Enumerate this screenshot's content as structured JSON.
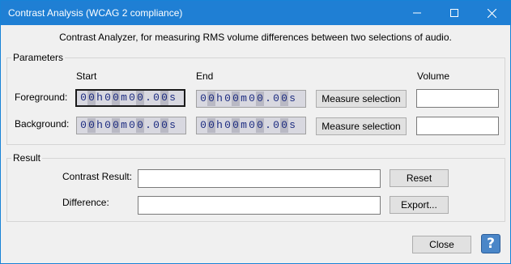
{
  "window": {
    "title": "Contrast Analysis (WCAG 2 compliance)",
    "controls": {
      "minimize": "minimize-icon",
      "maximize": "maximize-icon",
      "close": "close-icon"
    }
  },
  "description": "Contrast Analyzer, for measuring RMS volume differences between two selections of audio.",
  "parameters": {
    "group_label": "Parameters",
    "col_start": "Start",
    "col_end": "End",
    "col_volume": "Volume",
    "foreground": {
      "label": "Foreground:",
      "start": [
        "0",
        "0",
        "h",
        "0",
        "0",
        "m",
        "0",
        "0",
        ".",
        "0",
        "0",
        "s"
      ],
      "end": [
        "0",
        "0",
        "h",
        "0",
        "0",
        "m",
        "0",
        "0",
        ".",
        "0",
        "0",
        "s"
      ],
      "measure_label": "Measure selection",
      "volume": ""
    },
    "background": {
      "label": "Background:",
      "start": [
        "0",
        "0",
        "h",
        "0",
        "0",
        "m",
        "0",
        "0",
        ".",
        "0",
        "0",
        "s"
      ],
      "end": [
        "0",
        "0",
        "h",
        "0",
        "0",
        "m",
        "0",
        "0",
        ".",
        "0",
        "0",
        "s"
      ],
      "measure_label": "Measure selection",
      "volume": ""
    }
  },
  "result": {
    "group_label": "Result",
    "contrast_label": "Contrast Result:",
    "contrast_value": "",
    "reset_label": "Reset",
    "difference_label": "Difference:",
    "difference_value": "",
    "export_label": "Export..."
  },
  "footer": {
    "close_label": "Close",
    "help_glyph": "?"
  },
  "colors": {
    "titlebar": "#1f7fd4",
    "time_digit": "#1c2b80",
    "help_button": "#4a86c8"
  }
}
